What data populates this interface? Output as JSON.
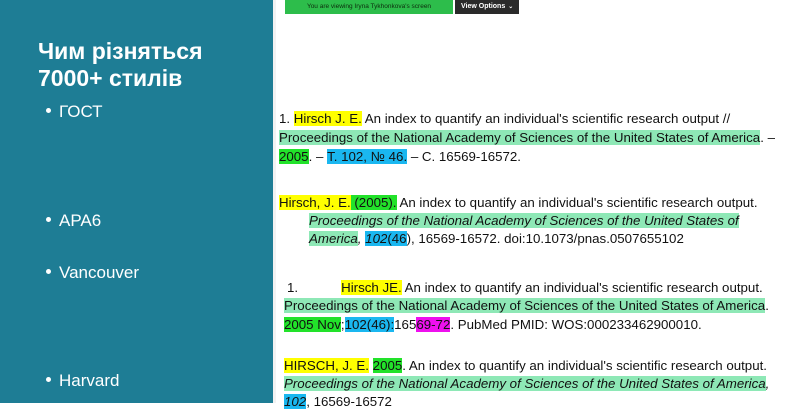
{
  "slide": {
    "title": "Чим різняться 7000+ стилів",
    "bullets": [
      "ГОСТ",
      "APA6",
      "Vancouver",
      "Harvard"
    ]
  },
  "zoom_bar": {
    "viewing_text": "You are viewing  Iryna Tykhonkova's screen",
    "options_label": "View Options"
  },
  "colors": {
    "sidebar": "#1e7d95",
    "highlight_yellow": "#ffff00",
    "highlight_green": "#8ee8b6",
    "highlight_lime": "#22e22a",
    "highlight_cyan": "#1ab7f0",
    "highlight_magenta": "#ee10ee"
  },
  "gost": {
    "num": "1. ",
    "author": "Hirsch J. E.",
    "title": " An index to quantify an individual's scientific research output //",
    "journal": "Proceedings of the National Academy of Sciences of the United States of America",
    "sep1": ". –",
    "year": "2005",
    "sep2": ". – ",
    "volume": "Т. 102, № 46.",
    "pages": " – С. 16569-16572."
  },
  "apa": {
    "author": "Hirsch, J. E.",
    "year": " (2005).",
    "title": " An index to quantify an individual's scientific research output.",
    "journal_line1": "Proceedings of the National Academy of Sciences of the United States of",
    "journal_line2": "America",
    "comma": ", ",
    "volume": "102",
    "issue": "(46",
    "rest": "), 16569-16572. doi:10.1073/pnas.0507655102"
  },
  "vancouver": {
    "num": "1.",
    "author": "Hirsch JE.",
    "title": " An index to quantify an individual's scientific research output.",
    "journal": "Proceedings of the National Academy of Sciences of the United States of America",
    "dot": ".",
    "date": "2005 Nov",
    "semi": ";",
    "volume": "102(46):",
    "pages_a": "165",
    "pages_b": "69-72",
    "rest": ". PubMed PMID: WOS:000233462900010."
  },
  "harvard": {
    "author": "HIRSCH, J. E.",
    "space": " ",
    "year": "2005",
    "title": ". An index to quantify an individual's scientific research output.",
    "journal": "Proceedings of the National Academy of Sciences of the United States of America",
    "comma": ",",
    "volume": "102",
    "rest": ", 16569-16572"
  }
}
